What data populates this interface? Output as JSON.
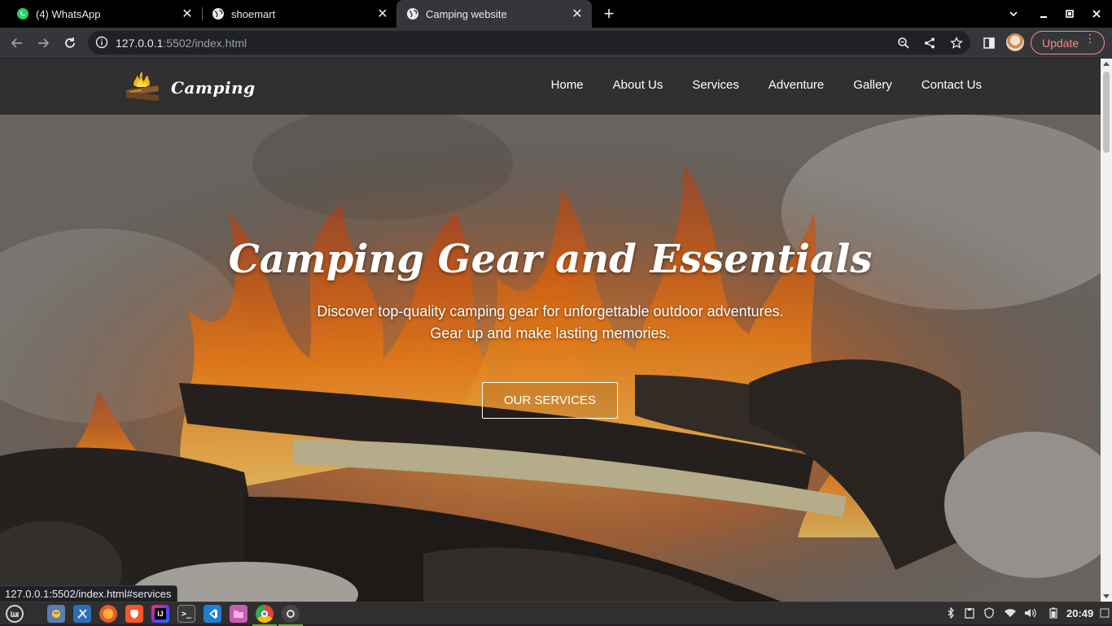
{
  "browser": {
    "tabs": [
      {
        "title": "(4) WhatsApp",
        "icon": "whatsapp-icon",
        "active": false
      },
      {
        "title": "shoemart",
        "icon": "globe-icon",
        "active": false
      },
      {
        "title": "Camping website",
        "icon": "globe-icon",
        "active": true
      }
    ],
    "url_host": "127.0.0.1",
    "url_path": ":5502/index.html",
    "update_label": "Update",
    "status_url": "127.0.0.1:5502/index.html#services"
  },
  "site": {
    "logo_text": "Camping",
    "nav": [
      "Home",
      "About Us",
      "Services",
      "Adventure",
      "Gallery",
      "Contact Us"
    ],
    "hero_title": "Camping Gear and Essentials",
    "hero_line1": "Discover top-quality camping gear for unforgettable outdoor adventures.",
    "hero_line2": "Gear up and make lasting memories.",
    "hero_button": "OUR SERVICES"
  },
  "taskbar": {
    "apps": [
      "mint-menu-icon",
      "files-icon",
      "settings-icon",
      "firefox-icon",
      "brave-icon",
      "intellij-icon",
      "terminal-icon",
      "vscode-icon",
      "folder-icon",
      "chrome-icon",
      "screenshot-icon"
    ],
    "clock": "20:49"
  },
  "colors": {
    "nav_bg": "#303030",
    "update_accent": "#f28b82",
    "fire_orange": "#ff8a1c"
  }
}
